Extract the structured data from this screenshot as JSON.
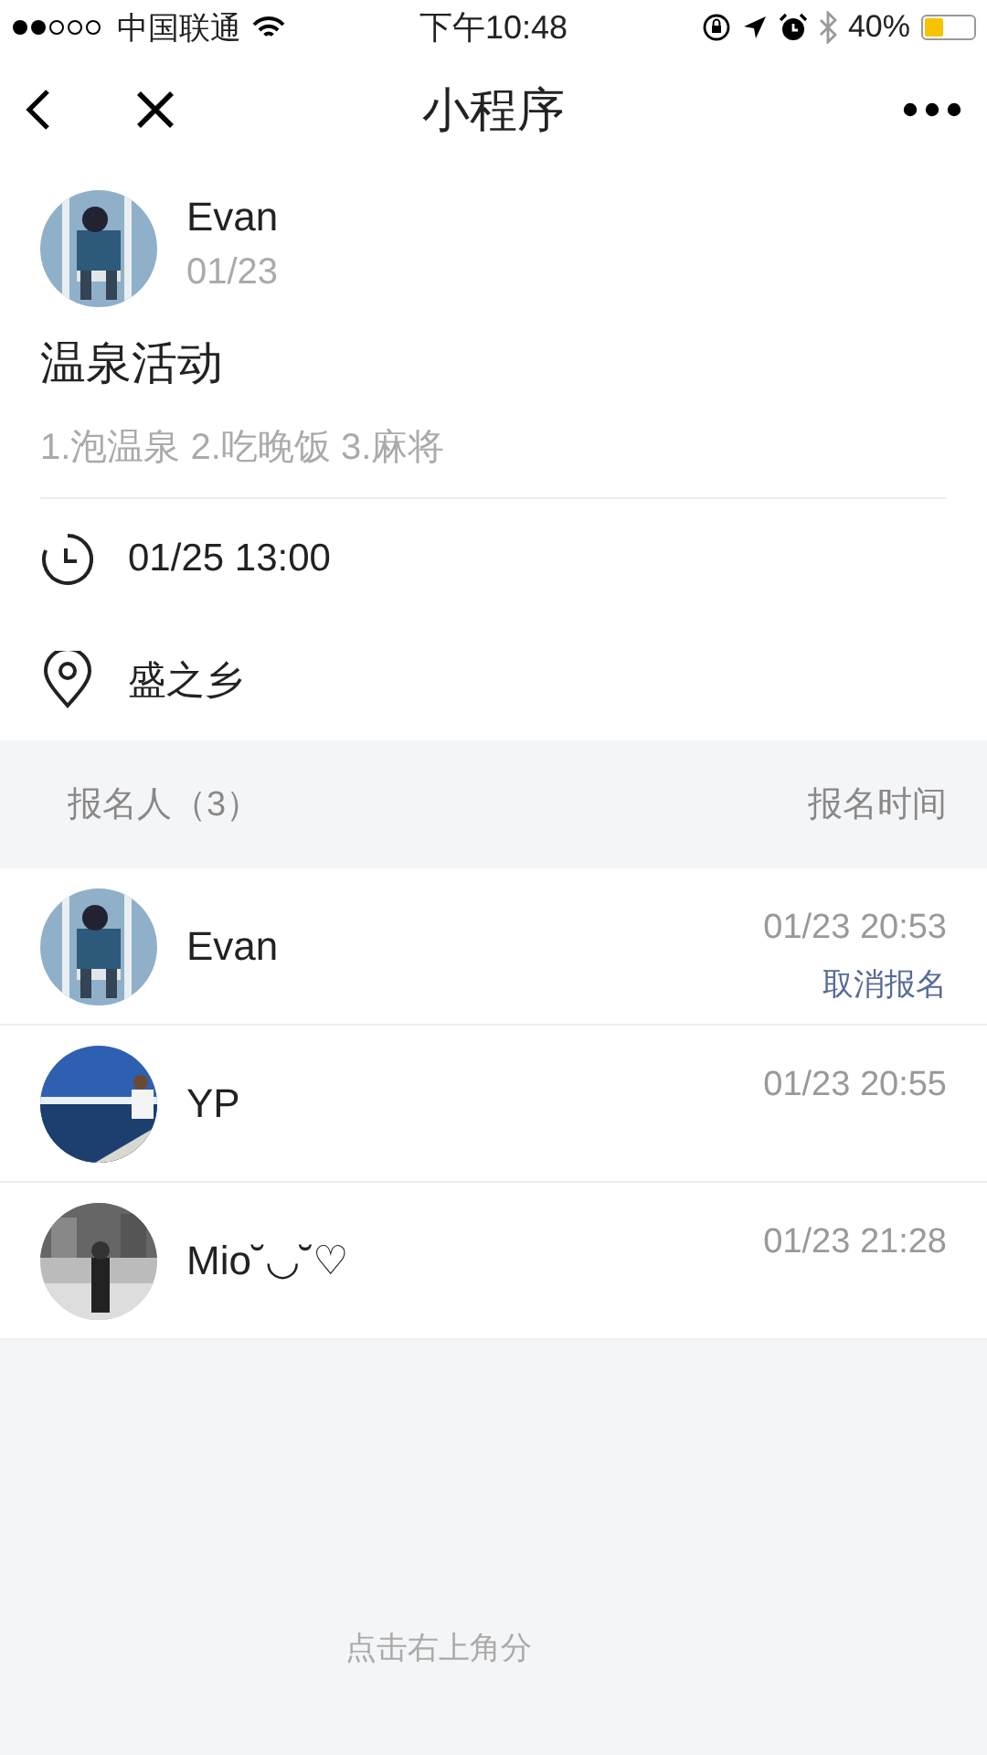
{
  "status_bar": {
    "carrier": "中国联通",
    "time": "下午10:48",
    "battery": "40%"
  },
  "nav": {
    "title": "小程序"
  },
  "post": {
    "author": "Evan",
    "date": "01/23",
    "title": "温泉活动",
    "description": "1.泡温泉 2.吃晚饭 3.麻将",
    "time": "01/25 13:00",
    "place": "盛之乡"
  },
  "signups": {
    "header": "报名人（3）",
    "time_header": "报名时间",
    "rows": [
      {
        "name": "Evan",
        "time": "01/23 20:53",
        "action": "取消报名"
      },
      {
        "name": "YP",
        "time": "01/23 20:55"
      },
      {
        "name": "Mio˘◡˘♡",
        "time": "01/23 21:28"
      }
    ]
  },
  "footer": {
    "hint": "点击右上角分"
  }
}
